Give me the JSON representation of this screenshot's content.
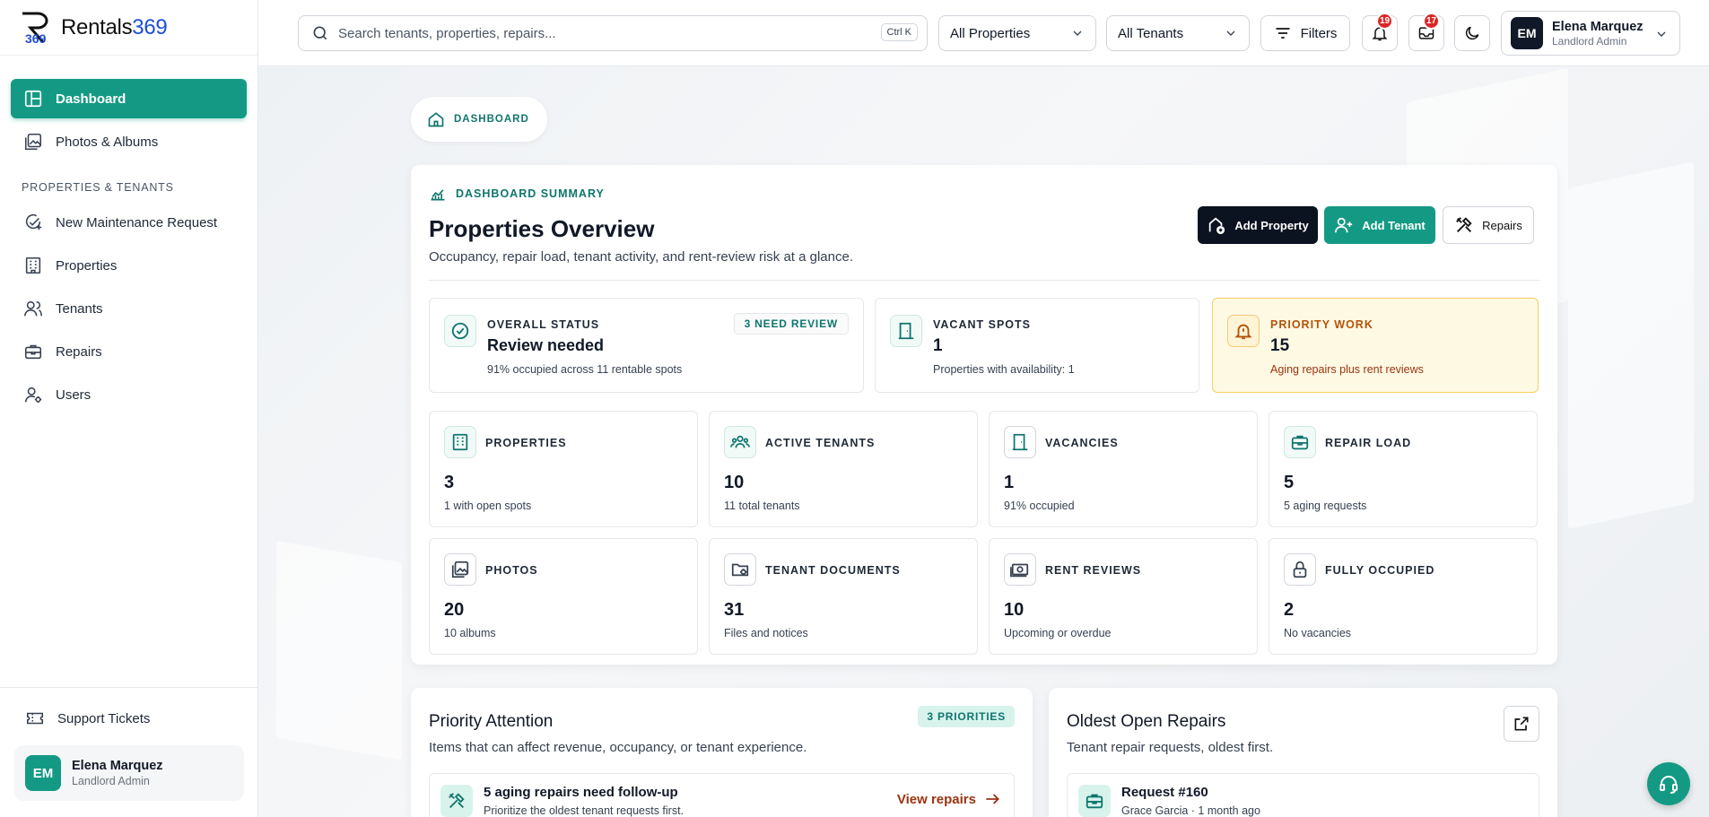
{
  "brand": {
    "name_main": "Rentals",
    "name_num": "369"
  },
  "sidebar": {
    "items": [
      {
        "label": "Dashboard",
        "icon": "dashboard-icon",
        "active": true
      },
      {
        "label": "Photos & Albums",
        "icon": "photos-icon"
      }
    ],
    "section": "PROPERTIES & TENANTS",
    "section_items": [
      {
        "label": "New Maintenance Request",
        "icon": "maintenance-icon"
      },
      {
        "label": "Properties",
        "icon": "building-icon"
      },
      {
        "label": "Tenants",
        "icon": "tenants-icon"
      },
      {
        "label": "Repairs",
        "icon": "toolbox-icon"
      },
      {
        "label": "Users",
        "icon": "users-icon"
      }
    ],
    "support": "Support Tickets",
    "user": {
      "initials": "EM",
      "name": "Elena Marquez",
      "role": "Landlord Admin"
    }
  },
  "topbar": {
    "search_placeholder": "Search tenants, properties, repairs...",
    "shortcut": "Ctrl K",
    "properties_filter": "All Properties",
    "tenants_filter": "All Tenants",
    "filters_label": "Filters",
    "notifications_count": "19",
    "messages_count": "17",
    "user": {
      "initials": "EM",
      "name": "Elena Marquez",
      "role": "Landlord Admin"
    }
  },
  "breadcrumb": "DASHBOARD",
  "summary": {
    "eyebrow": "DASHBOARD SUMMARY",
    "title": "Properties Overview",
    "subtitle": "Occupancy, repair load, tenant activity, and rent-review risk at a glance.",
    "actions": {
      "add_property": "Add Property",
      "add_tenant": "Add Tenant",
      "repairs": "Repairs"
    },
    "status": {
      "label": "OVERALL STATUS",
      "value": "Review needed",
      "note": "91% occupied across 11 rentable spots",
      "pill": "3 NEED REVIEW"
    },
    "vacant": {
      "label": "VACANT SPOTS",
      "value": "1",
      "note": "Properties with availability: 1"
    },
    "priority": {
      "label": "PRIORITY WORK",
      "value": "15",
      "note": "Aging repairs plus rent reviews"
    },
    "metrics": [
      {
        "label": "PROPERTIES",
        "value": "3",
        "note": "1 with open spots",
        "icon": "building-icon"
      },
      {
        "label": "ACTIVE TENANTS",
        "value": "10",
        "note": "11 total tenants",
        "icon": "tenants-group-icon"
      },
      {
        "label": "VACANCIES",
        "value": "1",
        "note": "91% occupied",
        "icon": "door-icon"
      },
      {
        "label": "REPAIR LOAD",
        "value": "5",
        "note": "5 aging requests",
        "icon": "toolbox-icon"
      },
      {
        "label": "PHOTOS",
        "value": "20",
        "note": "10 albums",
        "icon": "photos-icon"
      },
      {
        "label": "TENANT DOCUMENTS",
        "value": "31",
        "note": "Files and notices",
        "icon": "folder-gear-icon"
      },
      {
        "label": "RENT REVIEWS",
        "value": "10",
        "note": "Upcoming or overdue",
        "icon": "money-icon"
      },
      {
        "label": "FULLY OCCUPIED",
        "value": "2",
        "note": "No vacancies",
        "icon": "lock-icon"
      }
    ]
  },
  "priority_attention": {
    "title": "Priority Attention",
    "subtitle": "Items that can affect revenue, occupancy, or tenant experience.",
    "tag": "3 PRIORITIES",
    "item": {
      "title": "5 aging repairs need follow-up",
      "sub": "Prioritize the oldest tenant requests first.",
      "link": "View repairs"
    }
  },
  "oldest_repairs": {
    "title": "Oldest Open Repairs",
    "subtitle": "Tenant repair requests, oldest first.",
    "item": {
      "title": "Request #160",
      "sub": "Grace Garcia · 1 month ago"
    }
  }
}
